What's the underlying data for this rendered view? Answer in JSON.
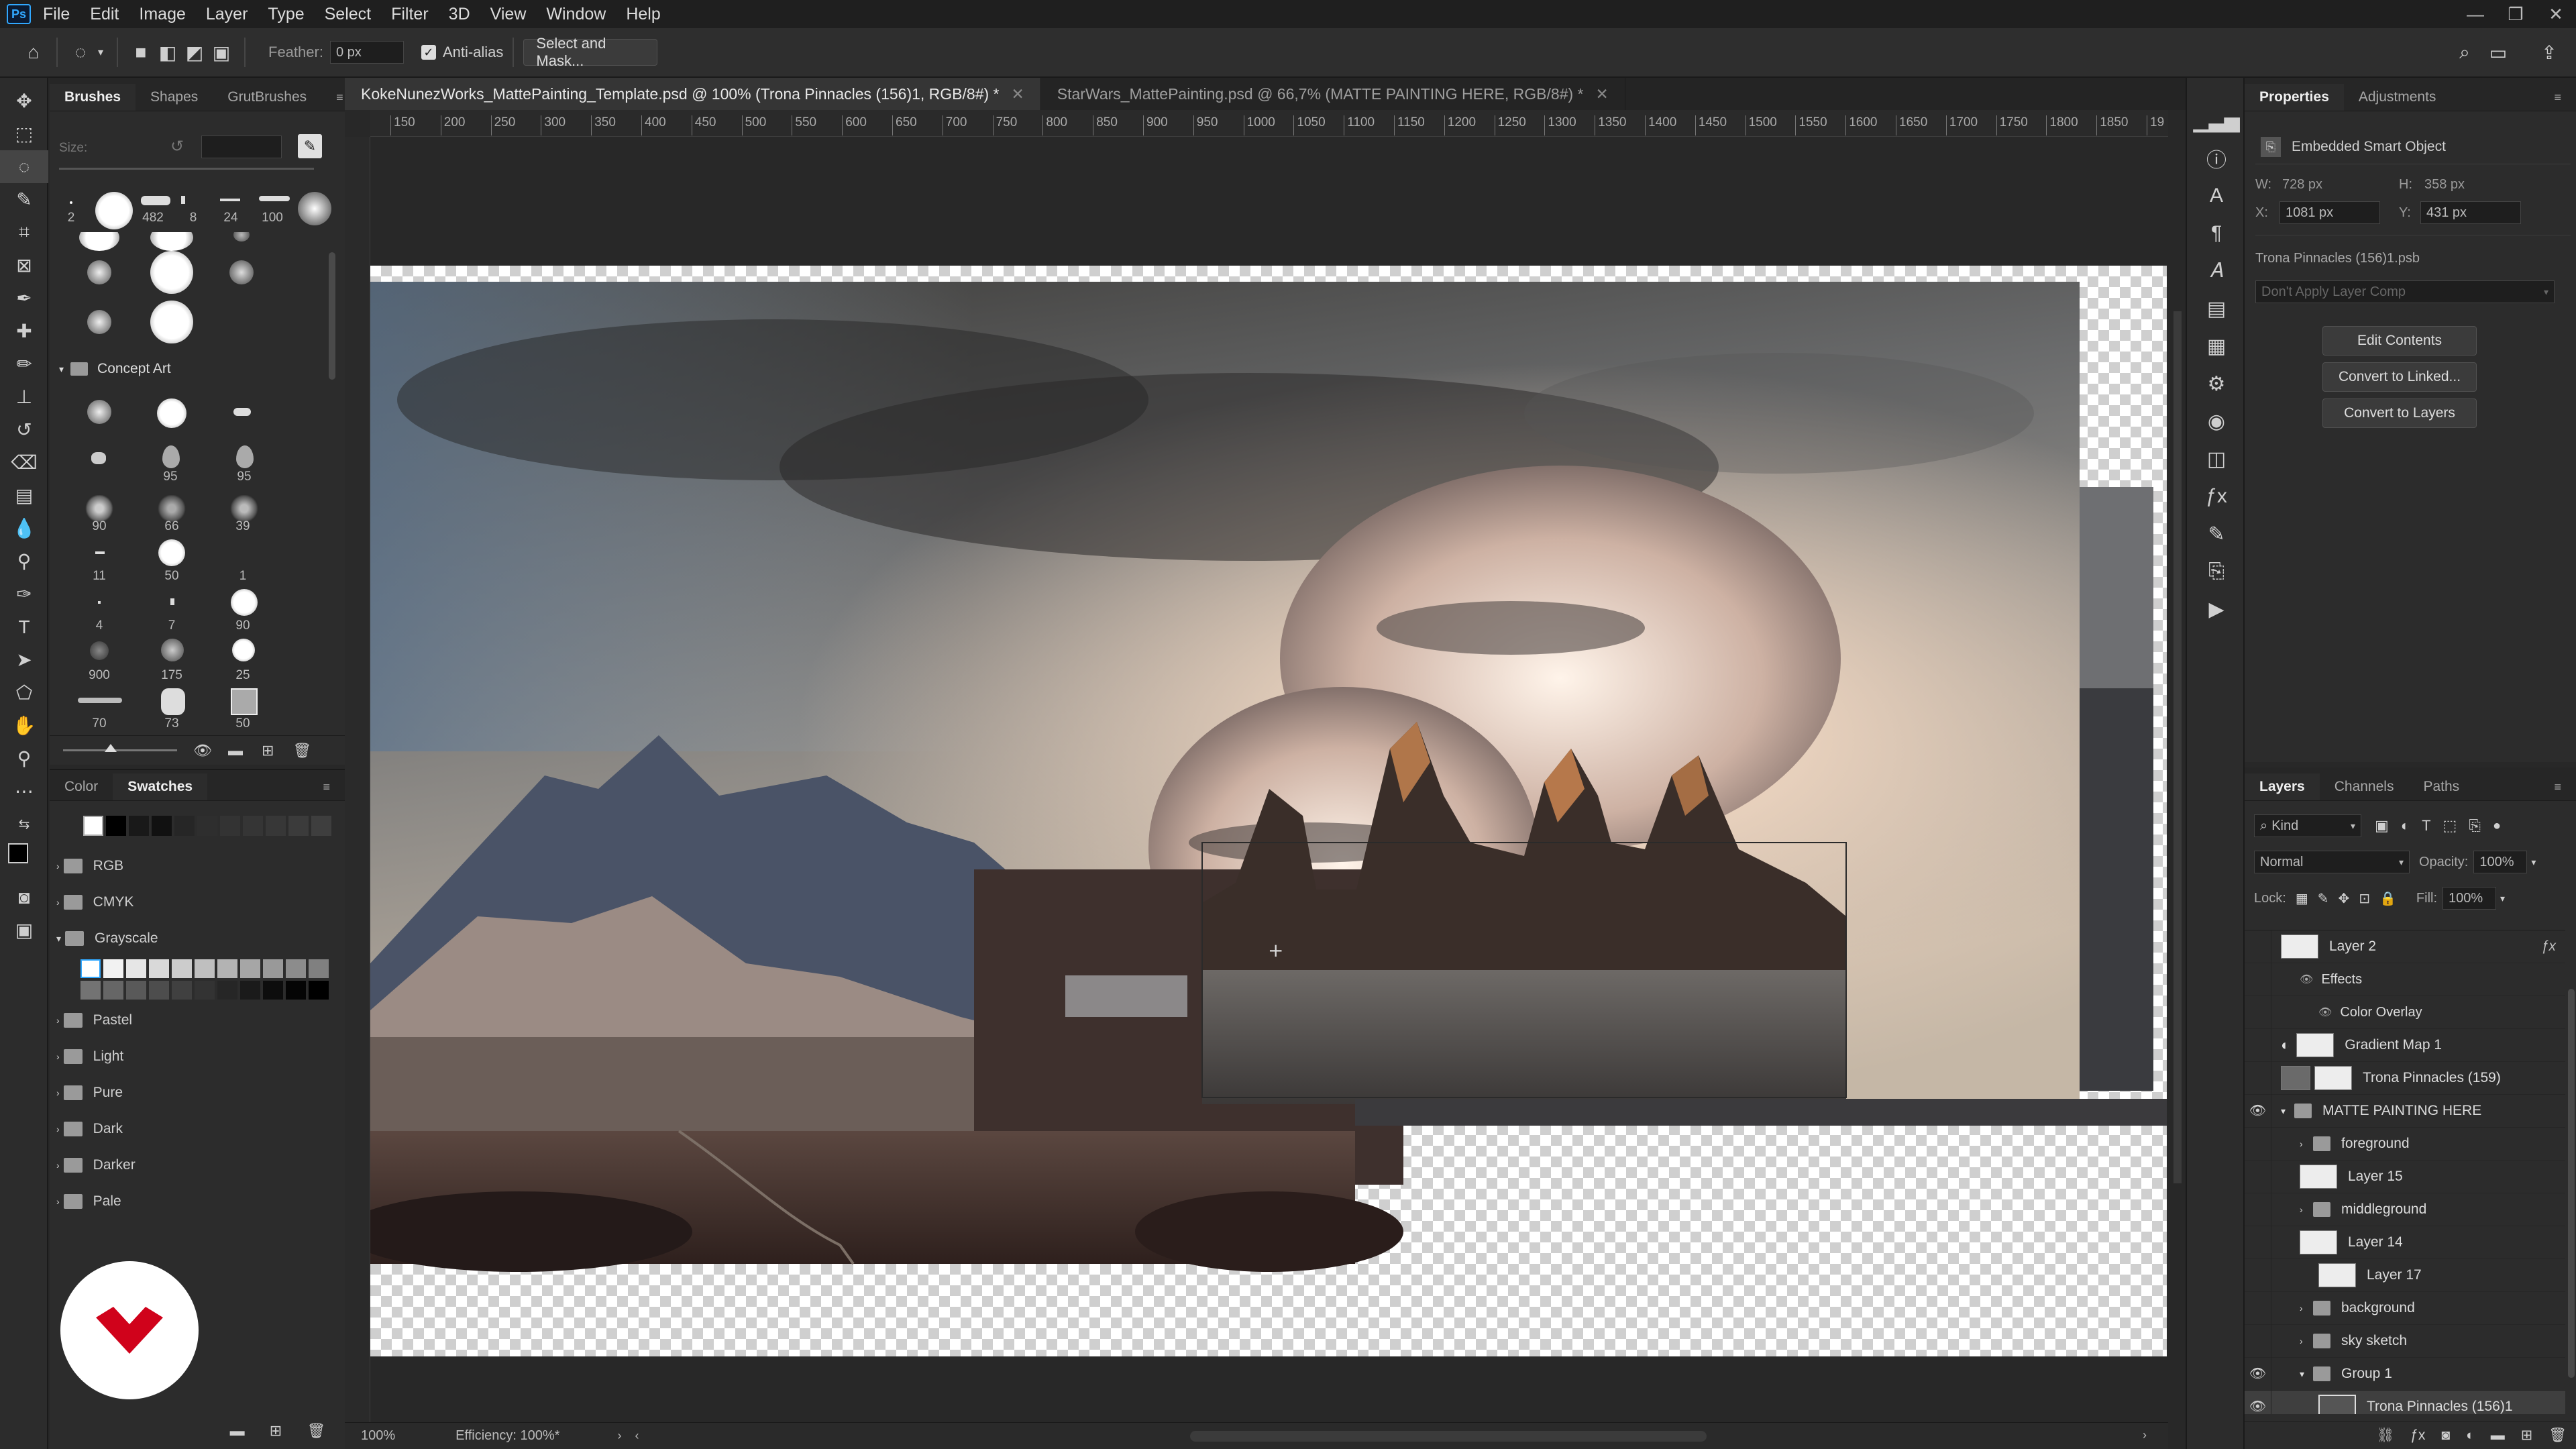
{
  "menu": {
    "logo": "Ps",
    "items": [
      "File",
      "Edit",
      "Image",
      "Layer",
      "Type",
      "Select",
      "Filter",
      "3D",
      "View",
      "Window",
      "Help"
    ]
  },
  "options": {
    "feather_label": "Feather:",
    "feather_value": "0 px",
    "antialias_label": "Anti-alias",
    "select_mask": "Select and Mask..."
  },
  "tabs": [
    {
      "title": "KokeNunezWorks_MattePainting_Template.psd @ 100% (Trona Pinnacles (156)1, RGB/8#) *",
      "active": true
    },
    {
      "title": "StarWars_MattePainting.psd @ 66,7% (MATTE PAINTING HERE, RGB/8#) *",
      "active": false
    }
  ],
  "ruler_h": [
    "150",
    "200",
    "250",
    "300",
    "350",
    "400",
    "450",
    "500",
    "550",
    "600",
    "650",
    "700",
    "750",
    "800",
    "850",
    "900",
    "950",
    "1000",
    "1050",
    "1100",
    "1150",
    "1200",
    "1250",
    "1300",
    "1350",
    "1400",
    "1450",
    "1500",
    "1550",
    "1600",
    "1650",
    "1700",
    "1750",
    "1800",
    "1850",
    "19"
  ],
  "status": {
    "zoom": "100%",
    "efficiency": "Efficiency: 100%*"
  },
  "brushes": {
    "tabs": [
      "Brushes",
      "Shapes",
      "GrutBrushes"
    ],
    "size_label": "Size:",
    "recent": [
      "2",
      "482",
      "8",
      "24",
      "100"
    ],
    "group": "Concept Art",
    "grid_nums": [
      "95",
      "95",
      "90",
      "66",
      "39",
      "11",
      "50",
      "1",
      "4",
      "7",
      "90",
      "900",
      "175",
      "25",
      "70",
      "73",
      "50"
    ]
  },
  "swatches": {
    "tabs": [
      "Color",
      "Swatches"
    ],
    "groups": [
      "RGB",
      "CMYK",
      "Grayscale",
      "Pastel",
      "Light",
      "Pure",
      "Dark",
      "Darker",
      "Pale"
    ]
  },
  "properties": {
    "tabs": [
      "Properties",
      "Adjustments"
    ],
    "type": "Embedded Smart Object",
    "w_label": "W:",
    "w": "728 px",
    "h_label": "H:",
    "h": "358 px",
    "x_label": "X:",
    "x": "1081 px",
    "y_label": "Y:",
    "y": "431 px",
    "file": "Trona Pinnacles (156)1.psb",
    "comp": "Don't Apply Layer Comp",
    "buttons": [
      "Edit Contents",
      "Convert to Linked...",
      "Convert to Layers"
    ]
  },
  "layers": {
    "tabs": [
      "Layers",
      "Channels",
      "Paths"
    ],
    "kind": "Kind",
    "blend": "Normal",
    "opacity_label": "Opacity:",
    "opacity": "100%",
    "lock_label": "Lock:",
    "fill_label": "Fill:",
    "fill": "100%",
    "items": [
      {
        "name": "Layer 2",
        "type": "layer",
        "indent": 0,
        "visible": false,
        "fx": true
      },
      {
        "name": "Effects",
        "type": "effects",
        "indent": 1,
        "visible": false
      },
      {
        "name": "Color Overlay",
        "type": "effect",
        "indent": 2,
        "visible": false
      },
      {
        "name": "Gradient Map 1",
        "type": "adjust",
        "indent": 0,
        "visible": false
      },
      {
        "name": "Trona Pinnacles (159)",
        "type": "smart",
        "indent": 0,
        "visible": false
      },
      {
        "name": "MATTE PAINTING HERE",
        "type": "group",
        "indent": 0,
        "visible": true
      },
      {
        "name": "foreground",
        "type": "group",
        "indent": 1,
        "visible": false
      },
      {
        "name": "Layer 15",
        "type": "layer",
        "indent": 1,
        "visible": false
      },
      {
        "name": "middleground",
        "type": "group",
        "indent": 1,
        "visible": false
      },
      {
        "name": "Layer 14",
        "type": "layer",
        "indent": 1,
        "visible": false
      },
      {
        "name": "Layer 17",
        "type": "layer",
        "indent": 2,
        "visible": false
      },
      {
        "name": "background",
        "type": "group",
        "indent": 1,
        "visible": false
      },
      {
        "name": "sky sketch",
        "type": "group",
        "indent": 1,
        "visible": false
      },
      {
        "name": "Group 1",
        "type": "group",
        "indent": 1,
        "visible": true
      },
      {
        "name": "Trona Pinnacles (156)1",
        "type": "smart",
        "indent": 2,
        "visible": true,
        "selected": true
      }
    ]
  },
  "colors": {
    "accent": "#31a8ff",
    "brand": "#d0021b"
  }
}
